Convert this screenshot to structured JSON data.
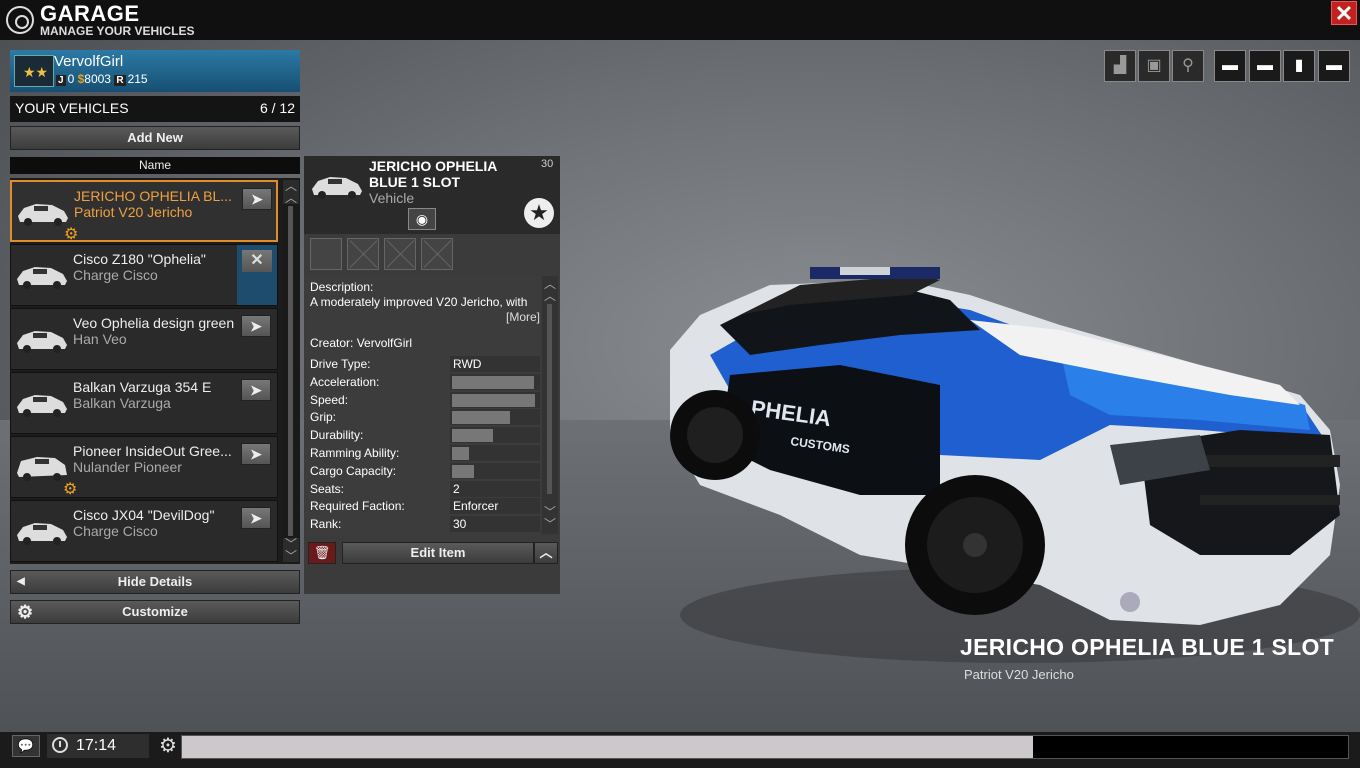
{
  "header": {
    "title": "GARAGE",
    "subtitle": "MANAGE YOUR VEHICLES",
    "close_label": "✕"
  },
  "player": {
    "name": "VervolfGirl",
    "j_label": "J",
    "j_value": "0",
    "money_icon": "$",
    "money": "8003",
    "r_label": "R",
    "r_value": "215",
    "rank_icon": "★★"
  },
  "vehicles_header": {
    "label": "YOUR VEHICLES",
    "count": "6 / 12"
  },
  "add_new_label": "Add New",
  "column_name": "Name",
  "vehicles": [
    {
      "name": "JERICHO OPHELIA BL...",
      "model": "Patriot V20 Jericho",
      "selected": true,
      "has_gear": true
    },
    {
      "name": "Cisco Z180 \"Ophelia\"",
      "model": "Charge Cisco",
      "action": "close"
    },
    {
      "name": "Veo Ophelia design green",
      "model": "Han Veo"
    },
    {
      "name": "Balkan Varzuga 354 E",
      "model": "Balkan Varzuga"
    },
    {
      "name": "Pioneer InsideOut Gree...",
      "model": "Nulander Pioneer",
      "has_gear": true
    },
    {
      "name": "Cisco JX04 \"DevilDog\"",
      "model": "Charge Cisco"
    }
  ],
  "hide_details_label": "Hide Details",
  "customize_label": "Customize",
  "detail": {
    "name": "JERICHO OPHELIA BLUE 1 SLOT",
    "number": "30",
    "type": "Vehicle",
    "description_label": "Description:",
    "description": "A moderately improved V20 Jericho, with",
    "more_label": "[More]",
    "creator_label": "Creator:",
    "creator": "VervolfGirl",
    "stats": [
      {
        "label": "Drive Type:",
        "value": "RWD"
      },
      {
        "label": "Acceleration:",
        "fill": 0.95
      },
      {
        "label": "Speed:",
        "fill": 0.97
      },
      {
        "label": "Grip:",
        "fill": 0.68
      },
      {
        "label": "Durability:",
        "fill": 0.48
      },
      {
        "label": "Ramming Ability:",
        "fill": 0.2
      },
      {
        "label": "Cargo Capacity:",
        "fill": 0.25
      },
      {
        "label": "Seats:",
        "value": "2"
      },
      {
        "label": "Required Faction:",
        "value": "Enforcer"
      },
      {
        "label": "Rank:",
        "value": "30"
      }
    ],
    "edit_label": "Edit Item"
  },
  "view_buttons": [
    "paint-icon",
    "engine-icon",
    "tools-icon",
    "car-side-icon",
    "car-front-icon",
    "car-top-icon",
    "car-rear-icon"
  ],
  "car_display": {
    "name": "JERICHO OPHELIA BLUE 1 SLOT",
    "model": "Patriot V20 Jericho"
  },
  "status": {
    "time": "17:14",
    "progress": 0.73
  },
  "colors": {
    "accent_orange": "#e28c2a",
    "close_red": "#c2211e",
    "player_blue": "#2b7aa5"
  }
}
